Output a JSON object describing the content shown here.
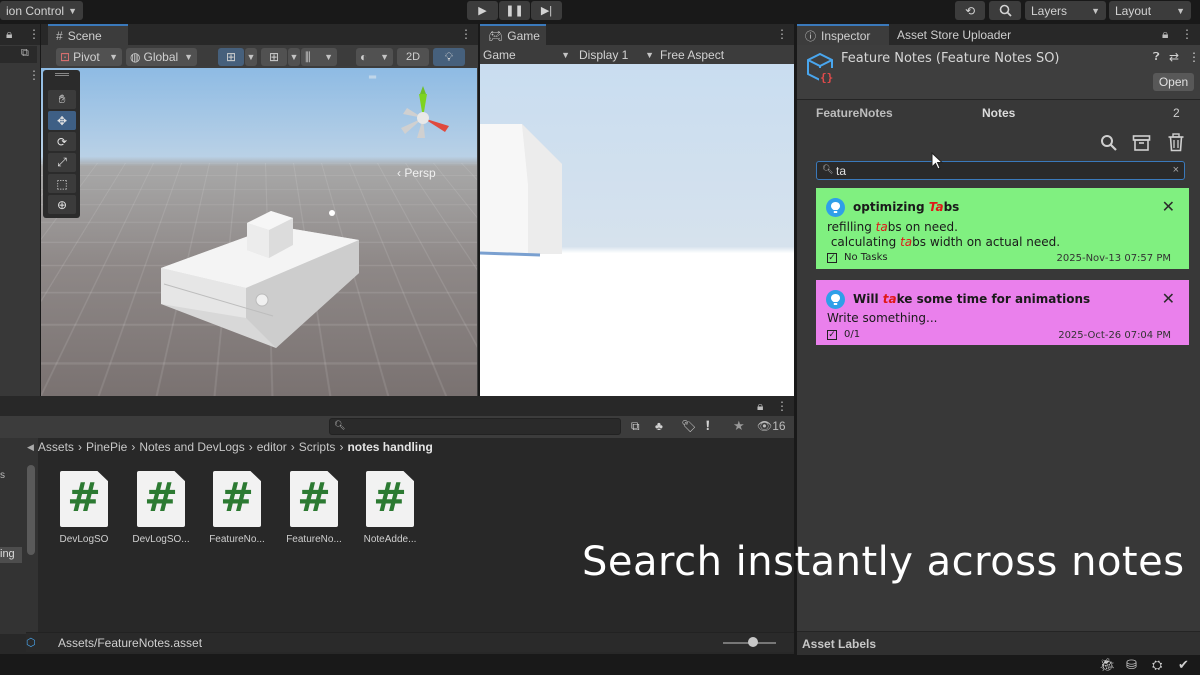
{
  "toolbar": {
    "version_control": "ion Control",
    "layers": "Layers",
    "layout": "Layout"
  },
  "scene": {
    "tab": "Scene",
    "pivot": "Pivot",
    "global": "Global",
    "mode_2d": "2D",
    "persp": "‹ Persp"
  },
  "game": {
    "tab": "Game",
    "mode": "Game",
    "display": "Display 1",
    "aspect": "Free Aspect"
  },
  "inspector": {
    "tab": "Inspector",
    "tab2": "Asset Store Uploader",
    "object_title": "Feature Notes (Feature Notes SO)",
    "open_button": "Open",
    "list_name": "FeatureNotes",
    "list_header": "Notes",
    "count": "2",
    "search_value": "ta",
    "notes": [
      {
        "title_pre": "optimizing ",
        "title_hl": "Ta",
        "title_post": "bs",
        "line1_pre": "refilling ",
        "line1_hl": "ta",
        "line1_post": "bs on need.",
        "line2_pre": " calculating ",
        "line2_hl": "ta",
        "line2_post": "bs width on actual need.",
        "tasks": "No Tasks",
        "date": "2025-Nov-13 07:57 PM",
        "color": "#80f080"
      },
      {
        "title_pre": "Will ",
        "title_hl": "ta",
        "title_post": "ke some time for animations",
        "body": "Write something...",
        "tasks": "0/1",
        "date": "2025-Oct-26 07:04 PM",
        "color": "#ea80ec"
      }
    ],
    "asset_labels": "Asset Labels"
  },
  "project": {
    "search_badge": "16",
    "breadcrumbs": [
      "Assets",
      "PinePie",
      "Notes and DevLogs",
      "editor",
      "Scripts",
      "notes handling"
    ],
    "assets": [
      "DevLogSO",
      "DevLogSO...",
      "FeatureNo...",
      "FeatureNo...",
      "NoteAdde..."
    ],
    "selected_path": "Assets/FeatureNotes.asset",
    "left_labels": [
      "s",
      "ing"
    ]
  },
  "caption": "Search instantly across notes",
  "colors": {
    "accent": "#3a79bb",
    "note_green": "#80f080",
    "note_pink": "#ea80ec",
    "bulb": "#2f9fe8"
  }
}
